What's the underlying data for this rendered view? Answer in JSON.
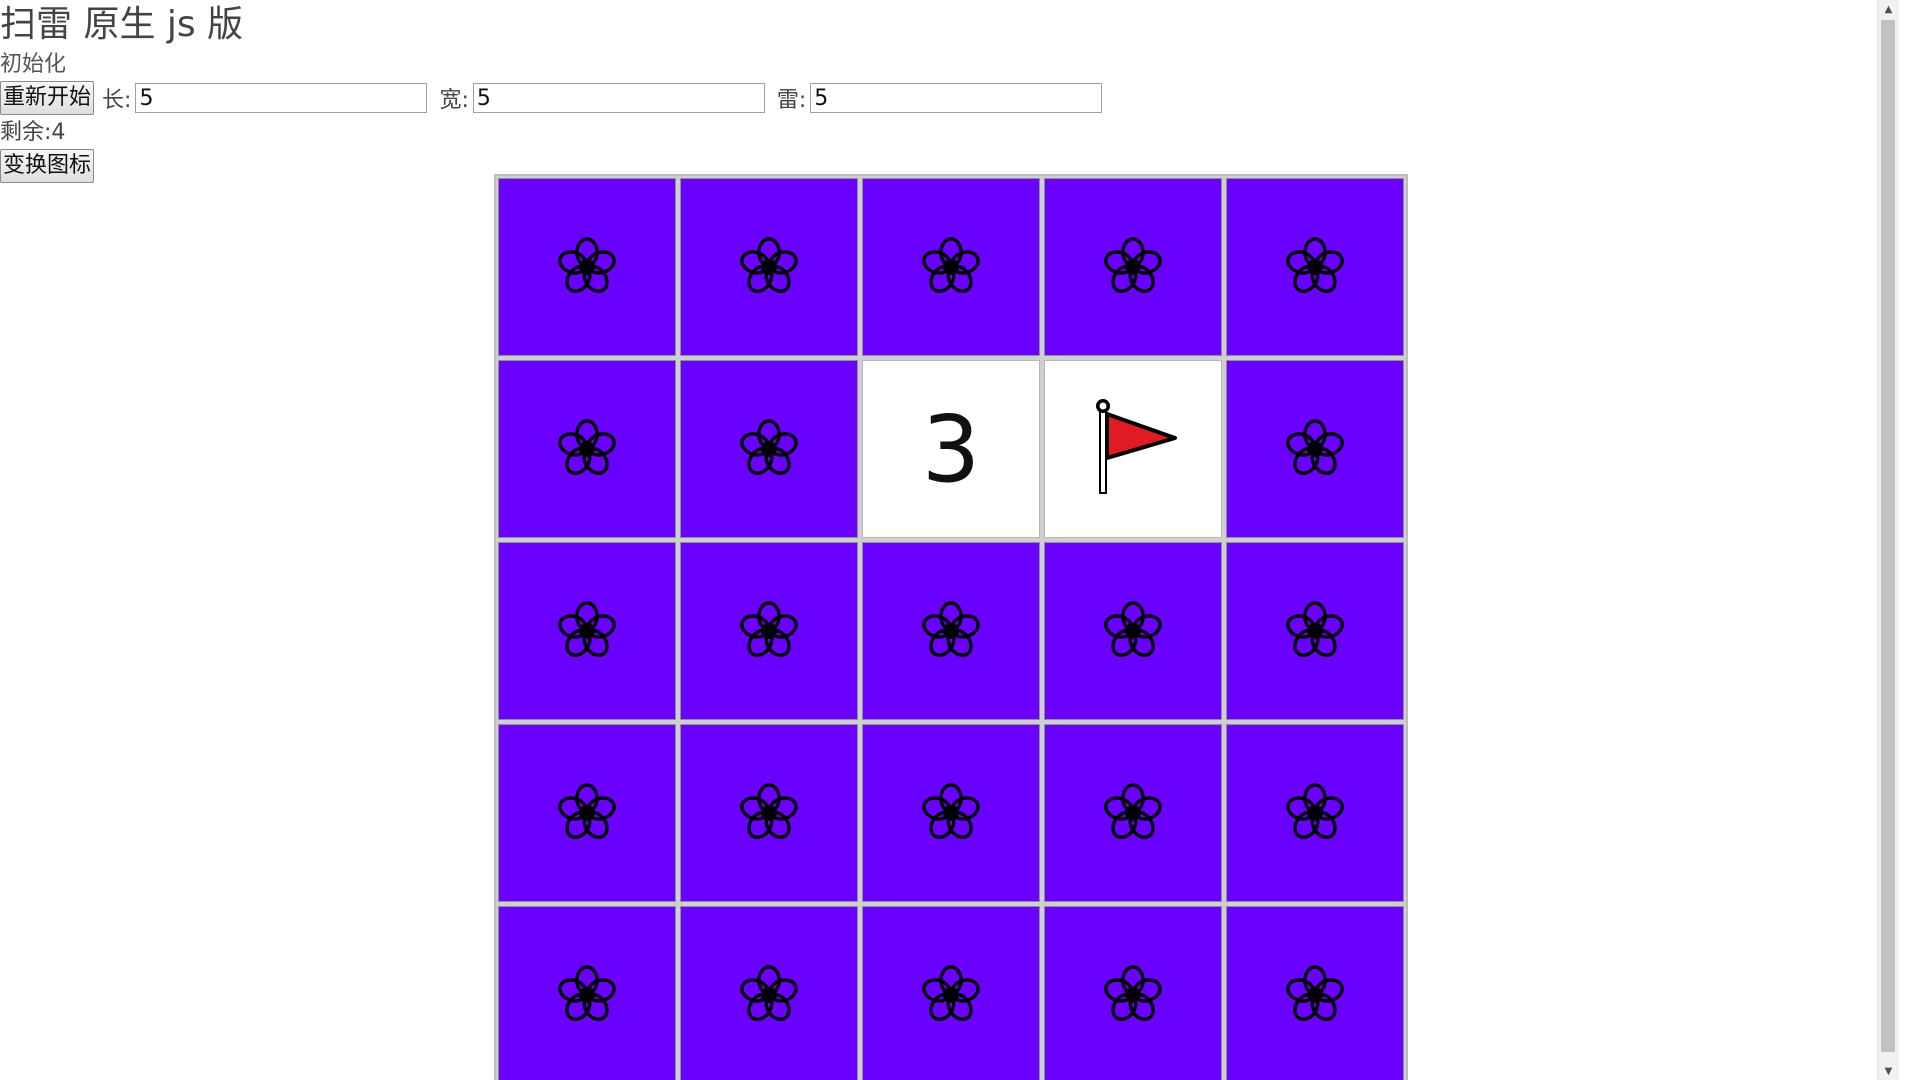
{
  "title": "扫雷 原生 js 版",
  "subtitle": "初始化",
  "controls": {
    "restart_label": "重新开始",
    "length_label": "长:",
    "length_value": "5",
    "width_label": "宽:",
    "width_value": "5",
    "mines_label": "雷:",
    "mines_value": "5"
  },
  "remaining_label": "剩余:",
  "remaining_value": "4",
  "switch_icon_label": "变换图标",
  "colors": {
    "covered_cell": "#6a00ff",
    "revealed_cell": "#ffffff",
    "flag": "#e01b24"
  },
  "board": {
    "rows": 5,
    "cols": 5,
    "cells": [
      [
        "covered",
        "covered",
        "covered",
        "covered",
        "covered"
      ],
      [
        "covered",
        "covered",
        "3",
        "flag",
        "covered"
      ],
      [
        "covered",
        "covered",
        "covered",
        "covered",
        "covered"
      ],
      [
        "covered",
        "covered",
        "covered",
        "covered",
        "covered"
      ],
      [
        "covered",
        "covered",
        "covered",
        "covered",
        "covered"
      ]
    ],
    "covered_icon": "flower-icon",
    "flag_icon": "flag-icon"
  }
}
